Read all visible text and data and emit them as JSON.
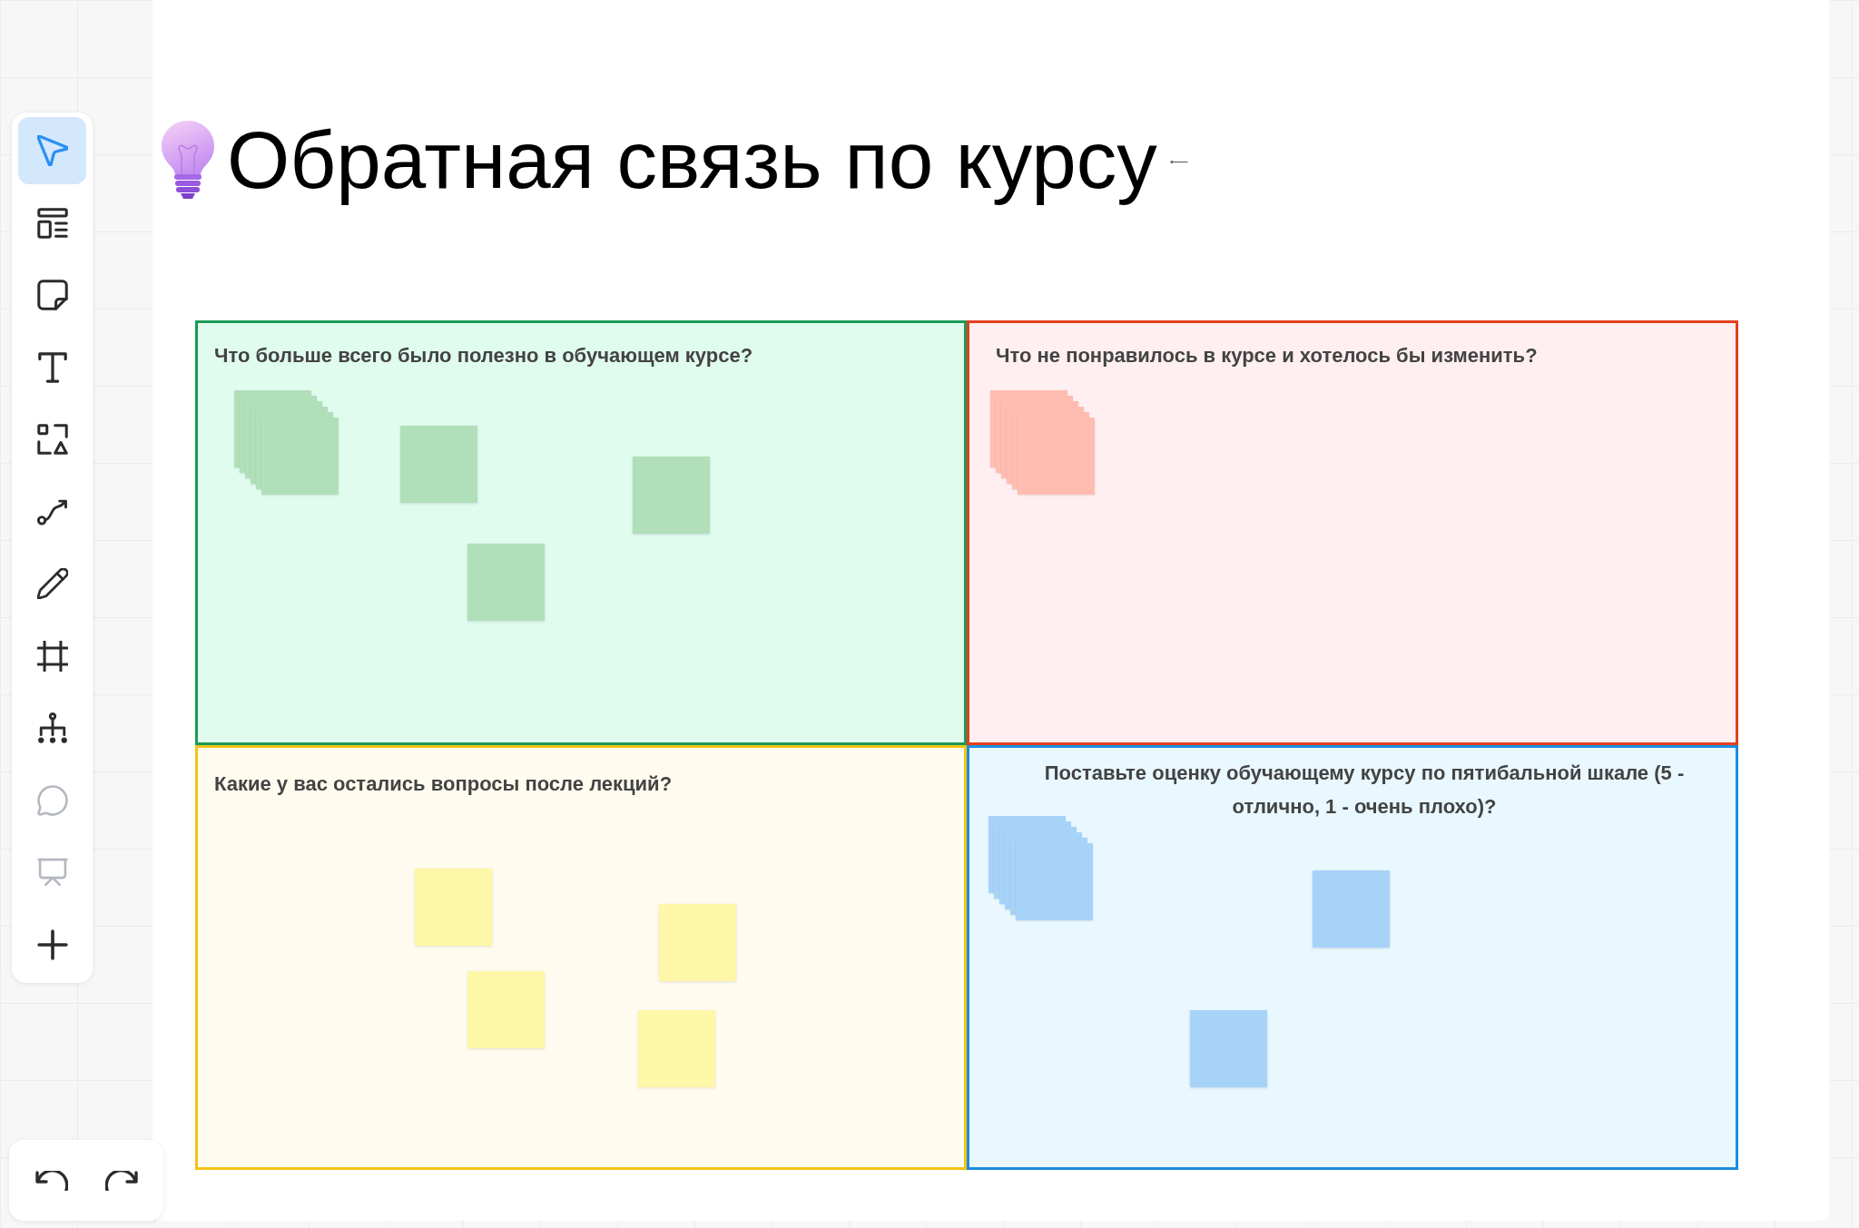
{
  "toolbar": {
    "tools": [
      {
        "selected": true,
        "disabled": false
      },
      {
        "selected": false,
        "disabled": false
      },
      {
        "selected": false,
        "disabled": false
      },
      {
        "selected": false,
        "disabled": false
      },
      {
        "selected": false,
        "disabled": false
      },
      {
        "selected": false,
        "disabled": false
      },
      {
        "selected": false,
        "disabled": false
      },
      {
        "selected": false,
        "disabled": false
      },
      {
        "selected": false,
        "disabled": false
      },
      {
        "selected": false,
        "disabled": true
      },
      {
        "selected": false,
        "disabled": true
      },
      {
        "selected": false,
        "disabled": false
      }
    ]
  },
  "board": {
    "title": "Обратная связь по курсу",
    "quadrants": [
      {
        "heading": "Что больше всего было полезно в обучающем курсе?",
        "color": "#1d9a55",
        "notes": [
          {
            "kind": "stack"
          },
          {
            "kind": "single"
          },
          {
            "kind": "single"
          },
          {
            "kind": "single"
          }
        ]
      },
      {
        "heading": "Что не понравилось в курсе и хотелось бы изменить?",
        "color": "#e2401f",
        "notes": [
          {
            "kind": "stack"
          }
        ]
      },
      {
        "heading": "Какие у вас остались вопросы после лекций?",
        "color": "#f2c318",
        "notes": [
          {
            "kind": "single"
          },
          {
            "kind": "single"
          },
          {
            "kind": "single"
          },
          {
            "kind": "single"
          }
        ]
      },
      {
        "heading": "Поставьте оценку обучающему курсу по пятибальной шкале (5 - отлично, 1 - очень плохо)?",
        "color": "#1b8ee0",
        "notes": [
          {
            "kind": "stack"
          },
          {
            "kind": "single"
          },
          {
            "kind": "single"
          }
        ]
      }
    ]
  }
}
